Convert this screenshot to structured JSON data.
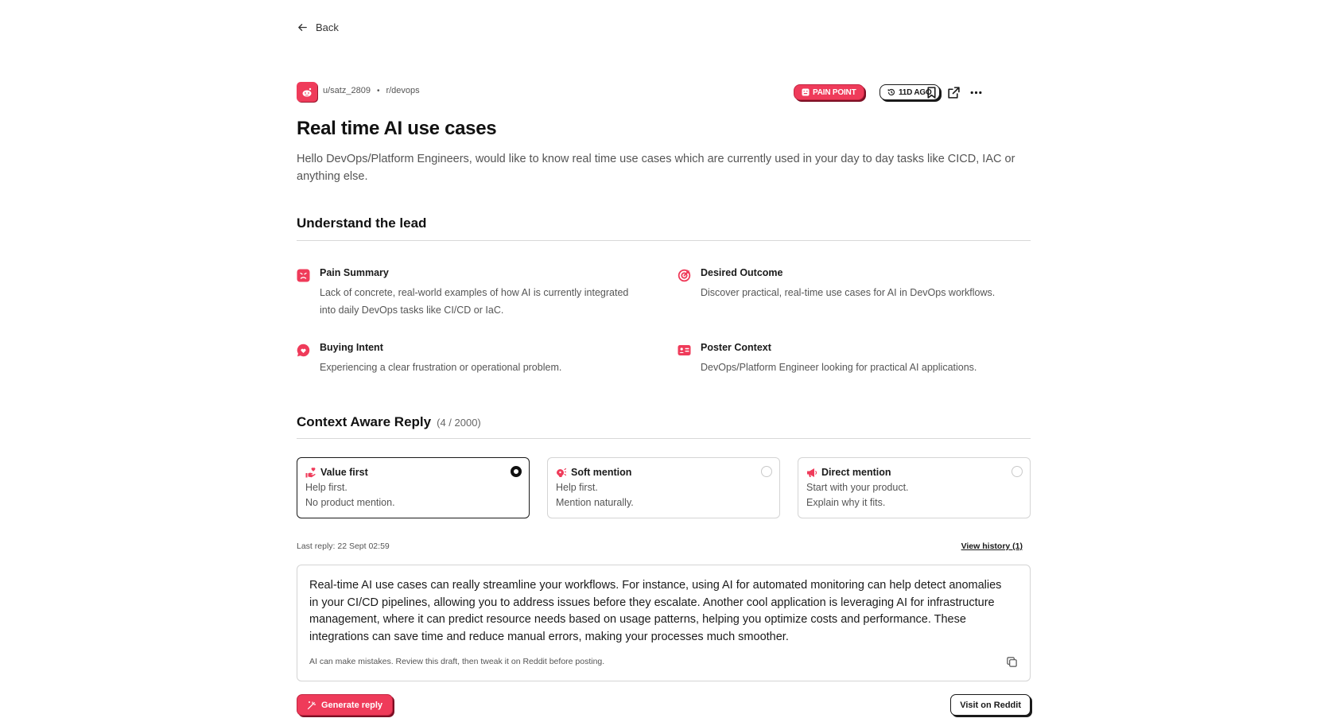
{
  "nav": {
    "back_label": "Back"
  },
  "post": {
    "user": "u/satz_2809",
    "separator": "•",
    "subreddit": "r/devops",
    "badge_type": "PAIN POINT",
    "badge_age": "11D AGO",
    "title": "Real time AI use cases",
    "body": "Hello DevOps/Platform Engineers, would like to know real time use cases which are currently used in your day to day tasks like CICD, IAC or anything else."
  },
  "understand": {
    "heading": "Understand the lead",
    "items": [
      {
        "title": "Pain Summary",
        "text": "Lack of concrete, real-world examples of how AI is currently integrated into daily DevOps tasks like CI/CD or IaC.",
        "icon": "frown-face-icon"
      },
      {
        "title": "Desired Outcome",
        "text": "Discover practical, real-time use cases for AI in DevOps workflows.",
        "icon": "target-icon"
      },
      {
        "title": "Buying Intent",
        "text": "Experiencing a clear frustration or operational problem.",
        "icon": "heart-chat-icon"
      },
      {
        "title": "Poster Context",
        "text": "DevOps/Platform Engineer looking for practical AI applications.",
        "icon": "id-card-icon"
      }
    ]
  },
  "reply": {
    "heading": "Context Aware Reply",
    "count": "(4 / 2000)",
    "options": [
      {
        "title": "Value first",
        "line1": "Help first.",
        "line2": "No product mention.",
        "selected": true
      },
      {
        "title": "Soft mention",
        "line1": "Help first.",
        "line2": "Mention naturally.",
        "selected": false
      },
      {
        "title": "Direct mention",
        "line1": "Start with your product.",
        "line2": "Explain why it fits.",
        "selected": false
      }
    ],
    "last_reply": "Last reply: 22 Sept 02:59",
    "history_link": "View history (1)",
    "draft": "Real-time AI use cases can really streamline your workflows. For instance, using AI for automated monitoring can help detect anomalies in your CI/CD pipelines, allowing you to address issues before they escalate. Another cool application is leveraging AI for infrastructure management, where it can predict resource needs based on usage patterns, helping you optimize costs and performance. These integrations can save time and reduce manual errors, making your processes much smoother.",
    "disclaimer": "AI can make mistakes. Review this draft, then tweak it on Reddit before posting.",
    "generate_label": "Generate reply",
    "visit_label": "Visit on Reddit"
  },
  "colors": {
    "accent": "#ef3b5a",
    "text": "#1a1a1a",
    "muted": "#555555",
    "border": "#d4d4d4"
  }
}
